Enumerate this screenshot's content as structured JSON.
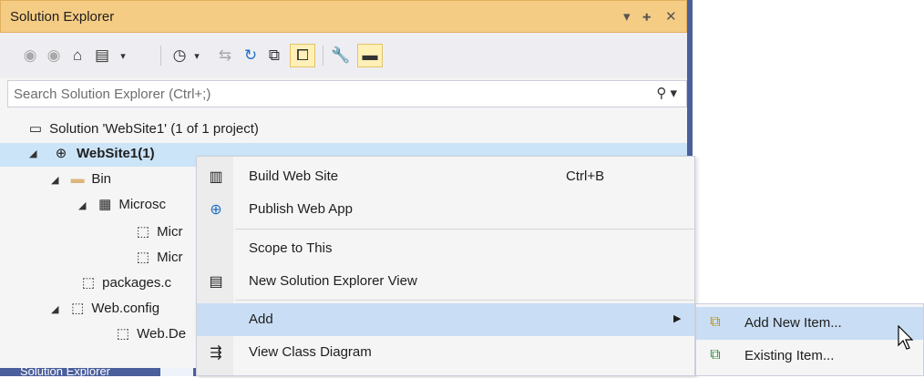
{
  "panel": {
    "title": "Solution Explorer",
    "controls": {
      "dropdown": "▾",
      "pin": "ᵖ",
      "close": "✕"
    }
  },
  "toolbar": {
    "icons": [
      "back-icon",
      "forward-icon",
      "home-icon",
      "switch-views-icon",
      "pending-changes-icon",
      "sync-icon",
      "refresh-icon",
      "collapse-all-icon",
      "show-all-files-icon",
      "properties-icon",
      "preview-icon"
    ]
  },
  "search": {
    "placeholder": "Search Solution Explorer (Ctrl+;)"
  },
  "tree": {
    "solution": "Solution 'WebSite1' (1 of 1 project)",
    "project": "WebSite1(1)",
    "bin": "Bin",
    "microsoft": "Microsc",
    "mic1": "Micr",
    "mic2": "Micr",
    "packages": "packages.c",
    "webconfig": "Web.config",
    "webde": "Web.De"
  },
  "bottom_tab": "Solution Explorer",
  "context_menu": {
    "items": [
      {
        "label": "Build Web Site",
        "shortcut": "Ctrl+B",
        "icon": "build-icon"
      },
      {
        "label": "Publish Web App",
        "icon": "publish-icon"
      },
      {
        "label": "Scope to This"
      },
      {
        "label": "New Solution Explorer View",
        "icon": "new-view-icon"
      },
      {
        "label": "Add",
        "icon": "submenu-arrow"
      },
      {
        "label": "View Class Diagram",
        "icon": "class-diagram-icon"
      }
    ]
  },
  "submenu": {
    "items": [
      {
        "label": "Add New Item...",
        "icon": "add-new-item-icon"
      },
      {
        "label": "Existing Item...",
        "icon": "existing-item-icon"
      }
    ]
  },
  "colors": {
    "title_bg": "#f5cc84",
    "selection": "#cce4f7",
    "menu_highlight": "#c9def5",
    "accent_border": "#4a5f9c"
  }
}
